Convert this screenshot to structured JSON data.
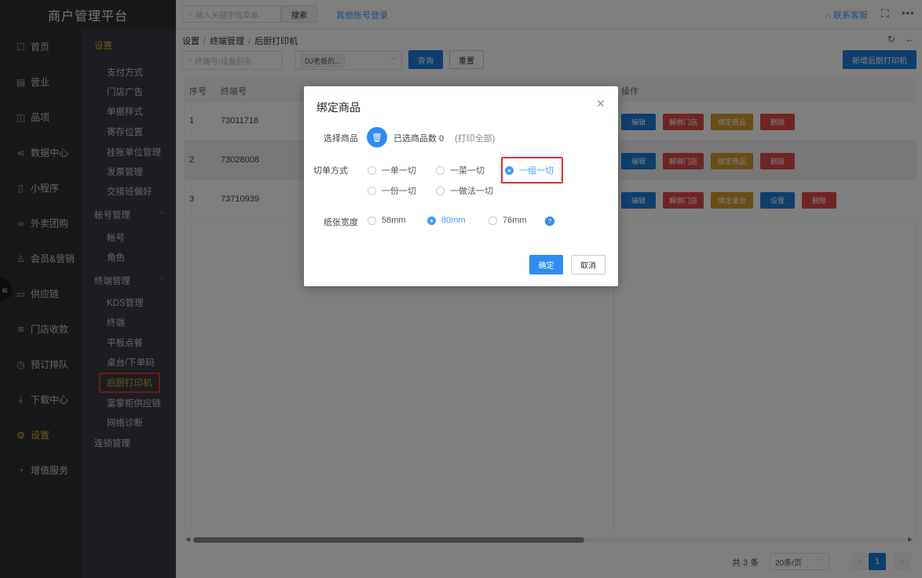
{
  "app": {
    "title": "商户管理平台"
  },
  "topbar": {
    "search_placeholder": "输入关键字找菜单",
    "search_button": "搜索",
    "other_login": "其他账号登录",
    "contact": "联系客服",
    "more": "•••"
  },
  "nav": {
    "items": [
      {
        "label": "首页",
        "icon": "home-icon",
        "glyph": "☐"
      },
      {
        "label": "营业",
        "icon": "calendar-icon",
        "glyph": "▤"
      },
      {
        "label": "品项",
        "icon": "bag-icon",
        "glyph": "◫"
      },
      {
        "label": "数据中心",
        "icon": "share-icon",
        "glyph": "⋖"
      },
      {
        "label": "小程序",
        "icon": "phone-icon",
        "glyph": "▯"
      },
      {
        "label": "外卖团购",
        "icon": "group-icon",
        "glyph": "∞"
      },
      {
        "label": "会员&营销",
        "icon": "user-icon",
        "glyph": "♙"
      },
      {
        "label": "供应链",
        "icon": "truck-icon",
        "glyph": "▭"
      },
      {
        "label": "门店收款",
        "icon": "database-icon",
        "glyph": "≋"
      },
      {
        "label": "预订排队",
        "icon": "clock-icon",
        "glyph": "◷"
      },
      {
        "label": "下载中心",
        "icon": "download-icon",
        "glyph": "⤓"
      },
      {
        "label": "设置",
        "icon": "gear-icon",
        "glyph": "⚙"
      },
      {
        "label": "增值服务",
        "icon": "alarm-icon",
        "glyph": "◔"
      }
    ]
  },
  "subnav": {
    "settings_group": "设置",
    "settings_items": [
      "支付方式",
      "门店广告",
      "单据样式",
      "寄存位置",
      "挂账单位管理",
      "发票管理",
      "交接班偏好"
    ],
    "account_group": "帐号管理",
    "account_items": [
      "帐号",
      "角色"
    ],
    "terminal_group": "终端管理",
    "terminal_items": [
      "KDS管理",
      "终端",
      "平板点餐",
      "桌台/下单码",
      "后厨打印机",
      "富掌柜供应链",
      "网络诊断"
    ],
    "chain_group": "连锁管理"
  },
  "breadcrumb": [
    "设置",
    "终端管理",
    "后厨打印机"
  ],
  "filters": {
    "input_placeholder": "终端号/设备别名",
    "select_tag": "DJ老板的...",
    "query": "查询",
    "reset": "重置",
    "add": "新增后厨打印机"
  },
  "table": {
    "headers": {
      "index": "序号",
      "terminal": "终端号",
      "ops": "操作"
    },
    "rows": [
      {
        "index": "1",
        "terminal": "73011718",
        "buttons": [
          {
            "label": "编辑",
            "color": "#1d7cdb"
          },
          {
            "label": "解绑门店",
            "color": "#e04b4b"
          },
          {
            "label": "绑定商品",
            "color": "#d39a2e"
          },
          {
            "label": "删除",
            "color": "#e04b4b"
          }
        ]
      },
      {
        "index": "2",
        "terminal": "73028008",
        "buttons": [
          {
            "label": "编辑",
            "color": "#1d7cdb"
          },
          {
            "label": "解绑门店",
            "color": "#e04b4b"
          },
          {
            "label": "绑定商品",
            "color": "#d39a2e"
          },
          {
            "label": "删除",
            "color": "#e04b4b"
          }
        ]
      },
      {
        "index": "3",
        "terminal": "73710939",
        "buttons": [
          {
            "label": "编辑",
            "color": "#1d7cdb"
          },
          {
            "label": "解绑门店",
            "color": "#e04b4b"
          },
          {
            "label": "绑定桌台",
            "color": "#d39a2e"
          },
          {
            "label": "设置",
            "color": "#1d7cdb"
          },
          {
            "label": "删除",
            "color": "#e04b4b"
          }
        ]
      }
    ]
  },
  "pagination": {
    "total": "共 3 条",
    "page_size": "20条/页",
    "current": "1"
  },
  "dialog": {
    "title": "绑定商品",
    "select_label": "选择商品",
    "selected_count": "已选商品数 0",
    "print_all": "(打印全部)",
    "cut_label": "切单方式",
    "cut_options": [
      "一单一切",
      "一菜一切",
      "一组一切",
      "一份一切",
      "一做法一切"
    ],
    "cut_selected": "一组一切",
    "paper_label": "纸张宽度",
    "paper_options": [
      "58mm",
      "80mm",
      "76mm"
    ],
    "paper_selected": "80mm",
    "confirm": "确定",
    "cancel": "取消"
  },
  "colors": {
    "accent": "#1d7cdb",
    "sidebar": "#2d3035",
    "highlight": "#e03030",
    "active_nav": "#e5a83a"
  }
}
